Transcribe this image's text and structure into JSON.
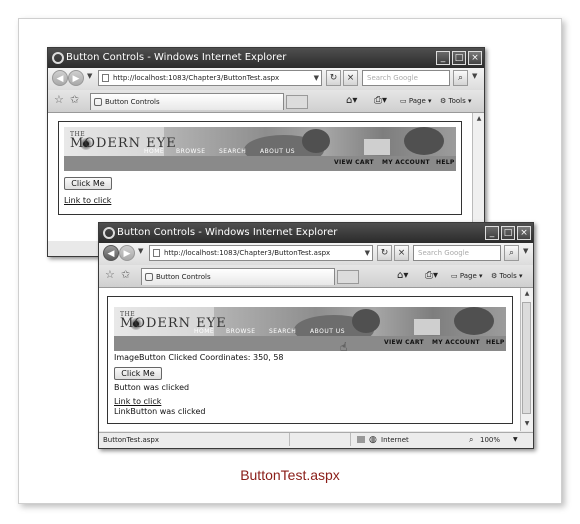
{
  "colors": {
    "caption": "#8a1d18",
    "titlebar": "#2b2b2b"
  },
  "back_window": {
    "title": "Button Controls - Windows Internet Explorer",
    "address": "http://localhost:1083/Chapter3/ButtonTest.aspx",
    "search_placeholder": "Search Google",
    "tab_label": "Button Controls",
    "tools": {
      "page": "Page",
      "tools": "Tools"
    },
    "banner": {
      "the": "THE",
      "brand": "MODERN EYE",
      "nav_top": [
        "HOME",
        "BROWSE",
        "SEARCH",
        "ABOUT US"
      ],
      "nav_bottom": [
        "VIEW CART",
        "MY ACCOUNT",
        "HELP"
      ]
    },
    "button_label": "Click Me",
    "link_text": "Link to click"
  },
  "front_window": {
    "title": "Button Controls - Windows Internet Explorer",
    "address": "http://localhost:1083/Chapter3/ButtonTest.aspx",
    "search_placeholder": "Search Google",
    "tab_label": "Button Controls",
    "tools": {
      "page": "Page",
      "tools": "Tools"
    },
    "banner": {
      "the": "THE",
      "brand": "MODERN EYE",
      "nav_top": [
        "HOME",
        "BROWSE",
        "SEARCH",
        "ABOUT US"
      ],
      "nav_bottom": [
        "VIEW CART",
        "MY ACCOUNT",
        "HELP"
      ]
    },
    "image_message": "ImageButton Clicked Coordinates: 350, 58",
    "button_label": "Click Me",
    "button_message": "Button was clicked",
    "link_text": "Link to click",
    "link_message": "LinkButton was clicked",
    "status": {
      "left": "ButtonTest.aspx",
      "zone": "Internet",
      "zoom": "100%"
    }
  },
  "caption": "ButtonTest.aspx"
}
